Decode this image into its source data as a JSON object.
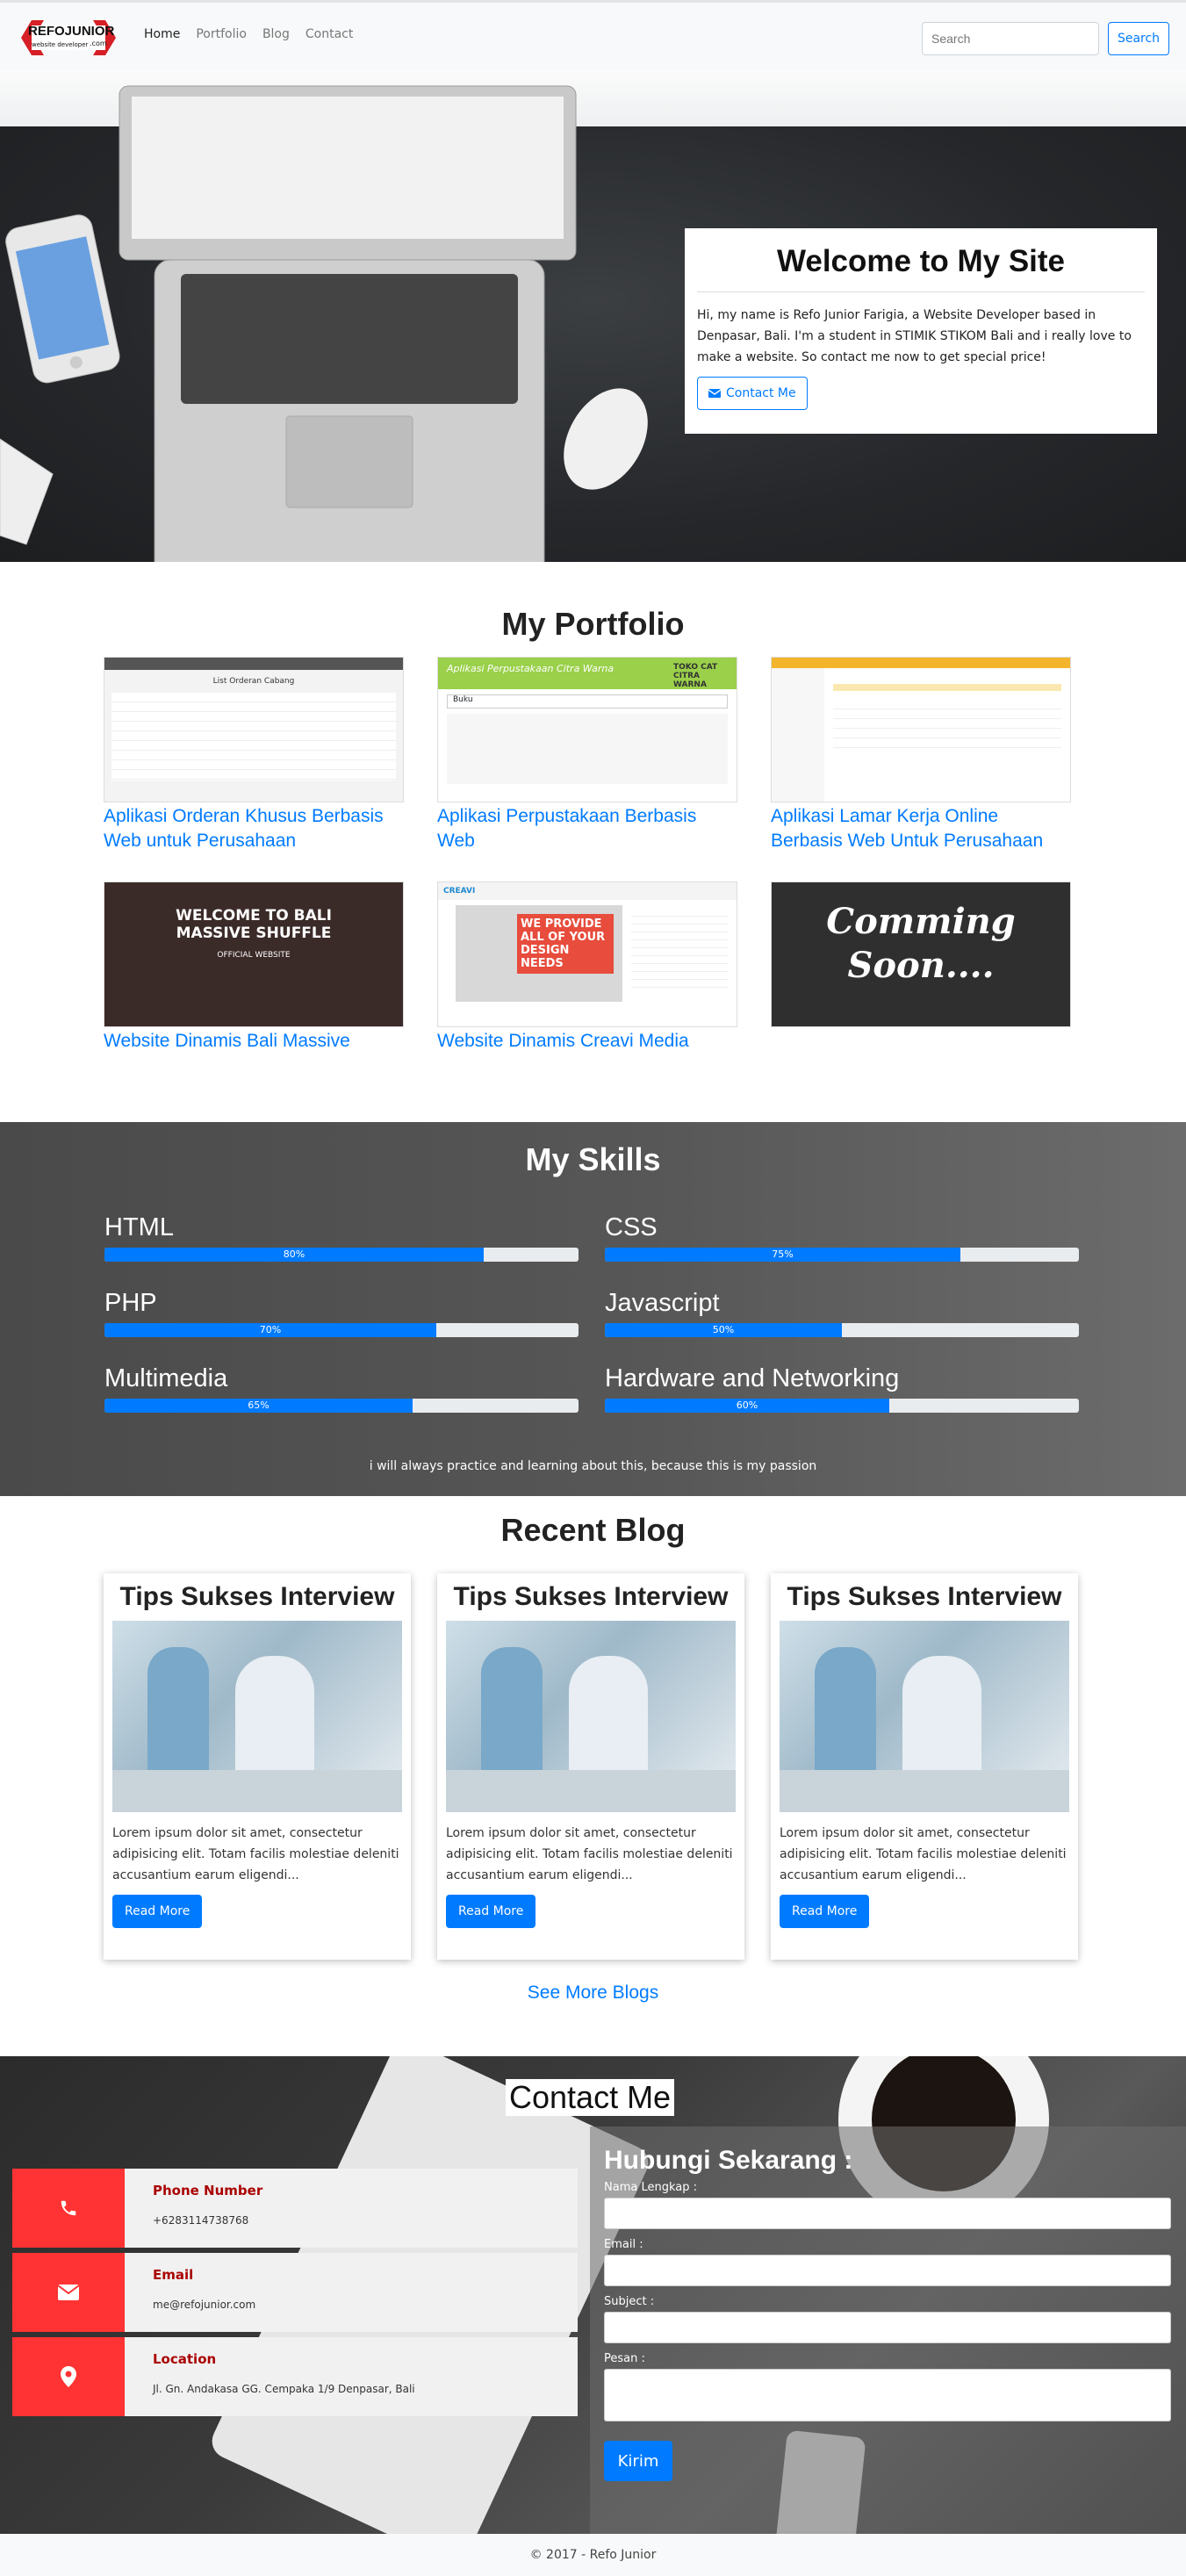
{
  "navbar": {
    "brand_name": "REFOJUNIOR",
    "brand_tagline": "website developer",
    "brand_suffix": ".com",
    "links": [
      "Home",
      "Portfolio",
      "Blog",
      "Contact"
    ],
    "search_placeholder": "Search",
    "search_button": "Search"
  },
  "hero": {
    "title": "Welcome to My Site",
    "text": "Hi, my name is Refo Junior Farigia, a Website Developer based in Denpasar, Bali. I'm a student in STIMIK STIKOM Bali and i really love to make a website. So contact me now to get special price!",
    "button": "Contact Me"
  },
  "portfolio": {
    "title": "My Portfolio",
    "items": [
      {
        "caption": "Aplikasi Orderan Khusus Berbasis Web untuk Perusahaan",
        "thumb_title": "List Orderan Cabang"
      },
      {
        "caption": "Aplikasi Perpustakaan Berbasis Web",
        "thumb_title": "Aplikasi Perpustakaan Citra Warna",
        "thumb_badge": "TOKO CAT CITRA WARNA",
        "thumb_field": "Buku"
      },
      {
        "caption": "Aplikasi Lamar Kerja Online Berbasis Web Untuk Perusahaan"
      },
      {
        "caption": "Website Dinamis Bali Massive Shuffle",
        "thumb_title": "WELCOME TO BALI MASSIVE SHUFFLE",
        "thumb_sub": "OFFICIAL WEBSITE"
      },
      {
        "caption": "Website Dinamis Creavi Media",
        "thumb_title": "WE PROVIDE ALL OF YOUR DESIGN NEEDS",
        "thumb_logo": "CREAVI"
      },
      {
        "caption": "",
        "thumb_title": "Comming Soon...."
      }
    ]
  },
  "skills": {
    "title": "My Skills",
    "items": [
      {
        "name": "HTML",
        "label": "80%",
        "value": 80
      },
      {
        "name": "CSS",
        "label": "75%",
        "value": 75
      },
      {
        "name": "PHP",
        "label": "70%",
        "value": 70
      },
      {
        "name": "Javascript",
        "label": "50%",
        "value": 50
      },
      {
        "name": "Multimedia",
        "label": "65%",
        "value": 65
      },
      {
        "name": "Hardware and Networking",
        "label": "60%",
        "value": 60
      }
    ],
    "note": "i will always practice and learning about this, because this is my passion"
  },
  "blog": {
    "title": "Recent Blog",
    "posts": [
      {
        "title": "Tips Sukses Interview",
        "text": "Lorem ipsum dolor sit amet, consectetur adipisicing elit. Totam facilis molestiae deleniti accusantium earum eligendi...",
        "button": "Read More"
      },
      {
        "title": "Tips Sukses Interview",
        "text": "Lorem ipsum dolor sit amet, consectetur adipisicing elit. Totam facilis molestiae deleniti accusantium earum eligendi...",
        "button": "Read More"
      },
      {
        "title": "Tips Sukses Interview",
        "text": "Lorem ipsum dolor sit amet, consectetur adipisicing elit. Totam facilis molestiae deleniti accusantium earum eligendi...",
        "button": "Read More"
      }
    ],
    "see_more": "See More Blogs"
  },
  "contact": {
    "title": "Contact Me",
    "info": [
      {
        "label": "Phone Number",
        "value": "+6283114738768",
        "icon": "phone-icon"
      },
      {
        "label": "Email",
        "value": "me@refojunior.com",
        "icon": "envelope-icon"
      },
      {
        "label": "Location",
        "value": "Jl. Gn. Andakasa GG. Cempaka 1/9 Denpasar, Bali",
        "icon": "map-marker-icon"
      }
    ],
    "form": {
      "heading": "Hubungi Sekarang :",
      "name_label": "Nama Lengkap :",
      "email_label": "Email :",
      "subject_label": "Subject :",
      "message_label": "Pesan :",
      "submit": "Kirim"
    }
  },
  "footer": {
    "text": "© 2017 - Refo Junior"
  },
  "colors": {
    "accent": "#007bff",
    "contact_red": "#ff3333",
    "navbar_bg": "#f8f9fa"
  }
}
